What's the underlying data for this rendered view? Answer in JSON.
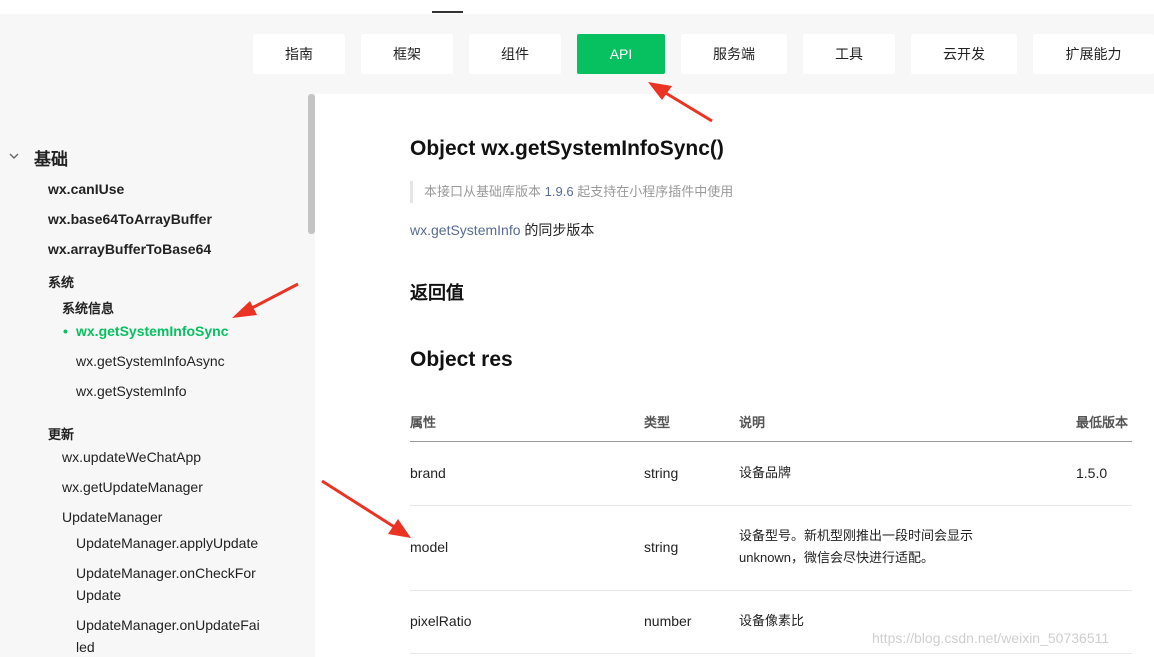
{
  "nav": {
    "items": [
      {
        "label": "指南"
      },
      {
        "label": "框架"
      },
      {
        "label": "组件"
      },
      {
        "label": "API"
      },
      {
        "label": "服务端"
      },
      {
        "label": "工具"
      },
      {
        "label": "云开发"
      },
      {
        "label": "扩展能力"
      }
    ],
    "active_color": "#07c160"
  },
  "sidebar": {
    "section": "基础",
    "items": [
      {
        "label": "wx.canIUse"
      },
      {
        "label": "wx.base64ToArrayBuffer"
      },
      {
        "label": "wx.arrayBufferToBase64"
      },
      {
        "label": "系统"
      },
      {
        "label": "系统信息"
      },
      {
        "label": "wx.getSystemInfoSync"
      },
      {
        "label": "wx.getSystemInfoAsync"
      },
      {
        "label": "wx.getSystemInfo"
      },
      {
        "label": "更新"
      },
      {
        "label": "wx.updateWeChatApp"
      },
      {
        "label": "wx.getUpdateManager"
      },
      {
        "label": "UpdateManager"
      },
      {
        "label": "UpdateManager.applyUpdate"
      },
      {
        "label": "UpdateManager.onCheckFor",
        "label2": "Update"
      },
      {
        "label": "UpdateManager.onUpdateFai",
        "label2": "led"
      }
    ]
  },
  "content": {
    "title": "Object wx.getSystemInfoSync()",
    "note_prefix": "本接口从基础库版本",
    "note_version": "1.9.6",
    "note_suffix": "起支持在小程序插件中使用",
    "sync_link": "wx.getSystemInfo",
    "sync_text": "的同步版本",
    "return_heading": "返回值",
    "object_heading": "Object res",
    "table": {
      "headers": [
        "属性",
        "类型",
        "说明",
        "最低版本"
      ],
      "rows": [
        {
          "name": "brand",
          "type": "string",
          "desc": "设备品牌",
          "min": "1.5.0"
        },
        {
          "name": "model",
          "type": "string",
          "desc": "设备型号。新机型刚推出一段时间会显示unknown，微信会尽快进行适配。",
          "min": ""
        },
        {
          "name": "pixelRatio",
          "type": "number",
          "desc": "设备像素比",
          "min": ""
        }
      ]
    }
  },
  "watermark": "https://blog.csdn.net/weixin_50736511",
  "arrow_color": "#ea3323"
}
